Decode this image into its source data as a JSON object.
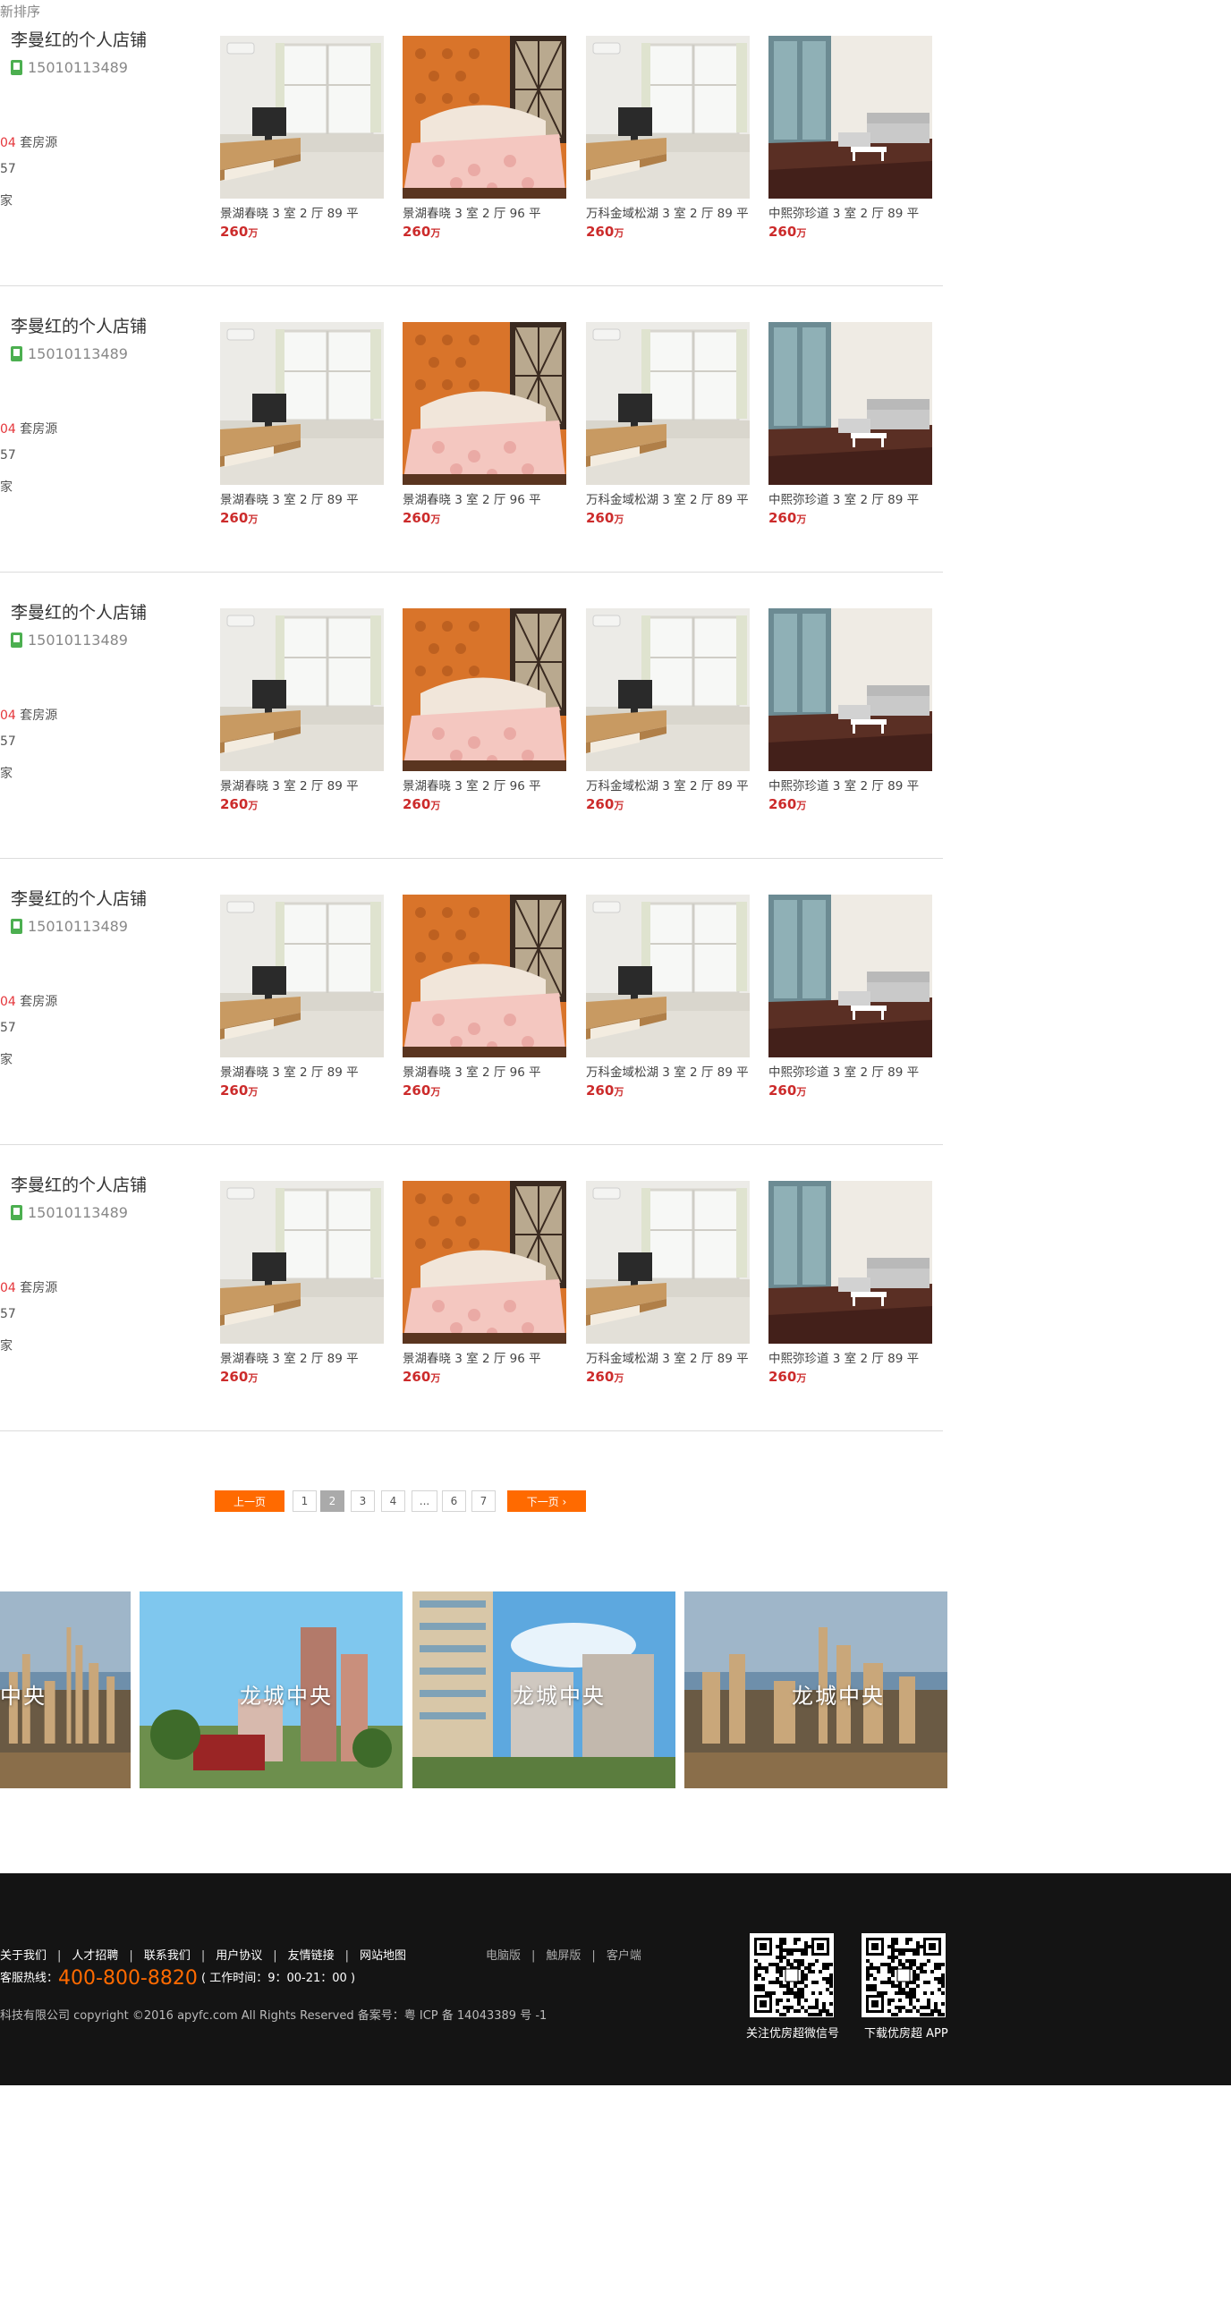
{
  "sort": {
    "label": "新排序"
  },
  "agents": [
    {
      "name": "李曼红的个人店铺",
      "phone": "15010113489",
      "houses_num": "04",
      "houses_label": "套房源",
      "stat2": "57",
      "stat3": "家"
    },
    {
      "name": "李曼红的个人店铺",
      "phone": "15010113489",
      "houses_num": "04",
      "houses_label": "套房源",
      "stat2": "57",
      "stat3": "家"
    },
    {
      "name": "李曼红的个人店铺",
      "phone": "15010113489",
      "houses_num": "04",
      "houses_label": "套房源",
      "stat2": "57",
      "stat3": "家"
    },
    {
      "name": "李曼红的个人店铺",
      "phone": "15010113489",
      "houses_num": "04",
      "houses_label": "套房源",
      "stat2": "57",
      "stat3": "家"
    },
    {
      "name": "李曼红的个人店铺",
      "phone": "15010113489",
      "houses_num": "04",
      "houses_label": "套房源",
      "stat2": "57",
      "stat3": "家"
    }
  ],
  "listings": [
    {
      "title": "景湖春晓  3 室 2 厅  89 平",
      "price": "260",
      "unit": "万",
      "image": "living-room-tv"
    },
    {
      "title": "景湖春晓  3 室 2 厅  96 平",
      "price": "260",
      "unit": "万",
      "image": "bedroom-orange"
    },
    {
      "title": "万科金域松湖  3 室 2 厅  89 平",
      "price": "260",
      "unit": "万",
      "image": "living-room-tv"
    },
    {
      "title": "中熙弥珍道  3 室 2 厅  89 平",
      "price": "260",
      "unit": "万",
      "image": "living-room-sofa"
    }
  ],
  "pagination": {
    "prev": "上一页",
    "pages": [
      "1",
      "2",
      "3",
      "4",
      "...",
      "6",
      "7"
    ],
    "active": "2",
    "next": "下一页 ›"
  },
  "banners": [
    {
      "label": "中央"
    },
    {
      "label": "龙城中央"
    },
    {
      "label": "龙城中央"
    },
    {
      "label": "龙城中央"
    }
  ],
  "footer": {
    "links": [
      "关于我们",
      "人才招聘",
      "联系我们",
      "用户协议",
      "友情链接",
      "网站地图"
    ],
    "versions": [
      "电脑版",
      "触屏版",
      "客户端"
    ],
    "hotline_label": "客服热线：",
    "hotline_number": "400-800-8820",
    "hotline_hours": "( 工作时间：9：00-21：00 )",
    "copyright": "科技有限公司  copyright ©2016  apyfc.com    All Rights  Reserved    备案号：粤 ICP 备 14043389 号 -1",
    "qr_labels": [
      "关注优房超微信号",
      "下载优房超 APP"
    ]
  },
  "colors": {
    "accent": "#ff6a00",
    "price": "#cc2b2b",
    "footer_bg": "#141414"
  }
}
